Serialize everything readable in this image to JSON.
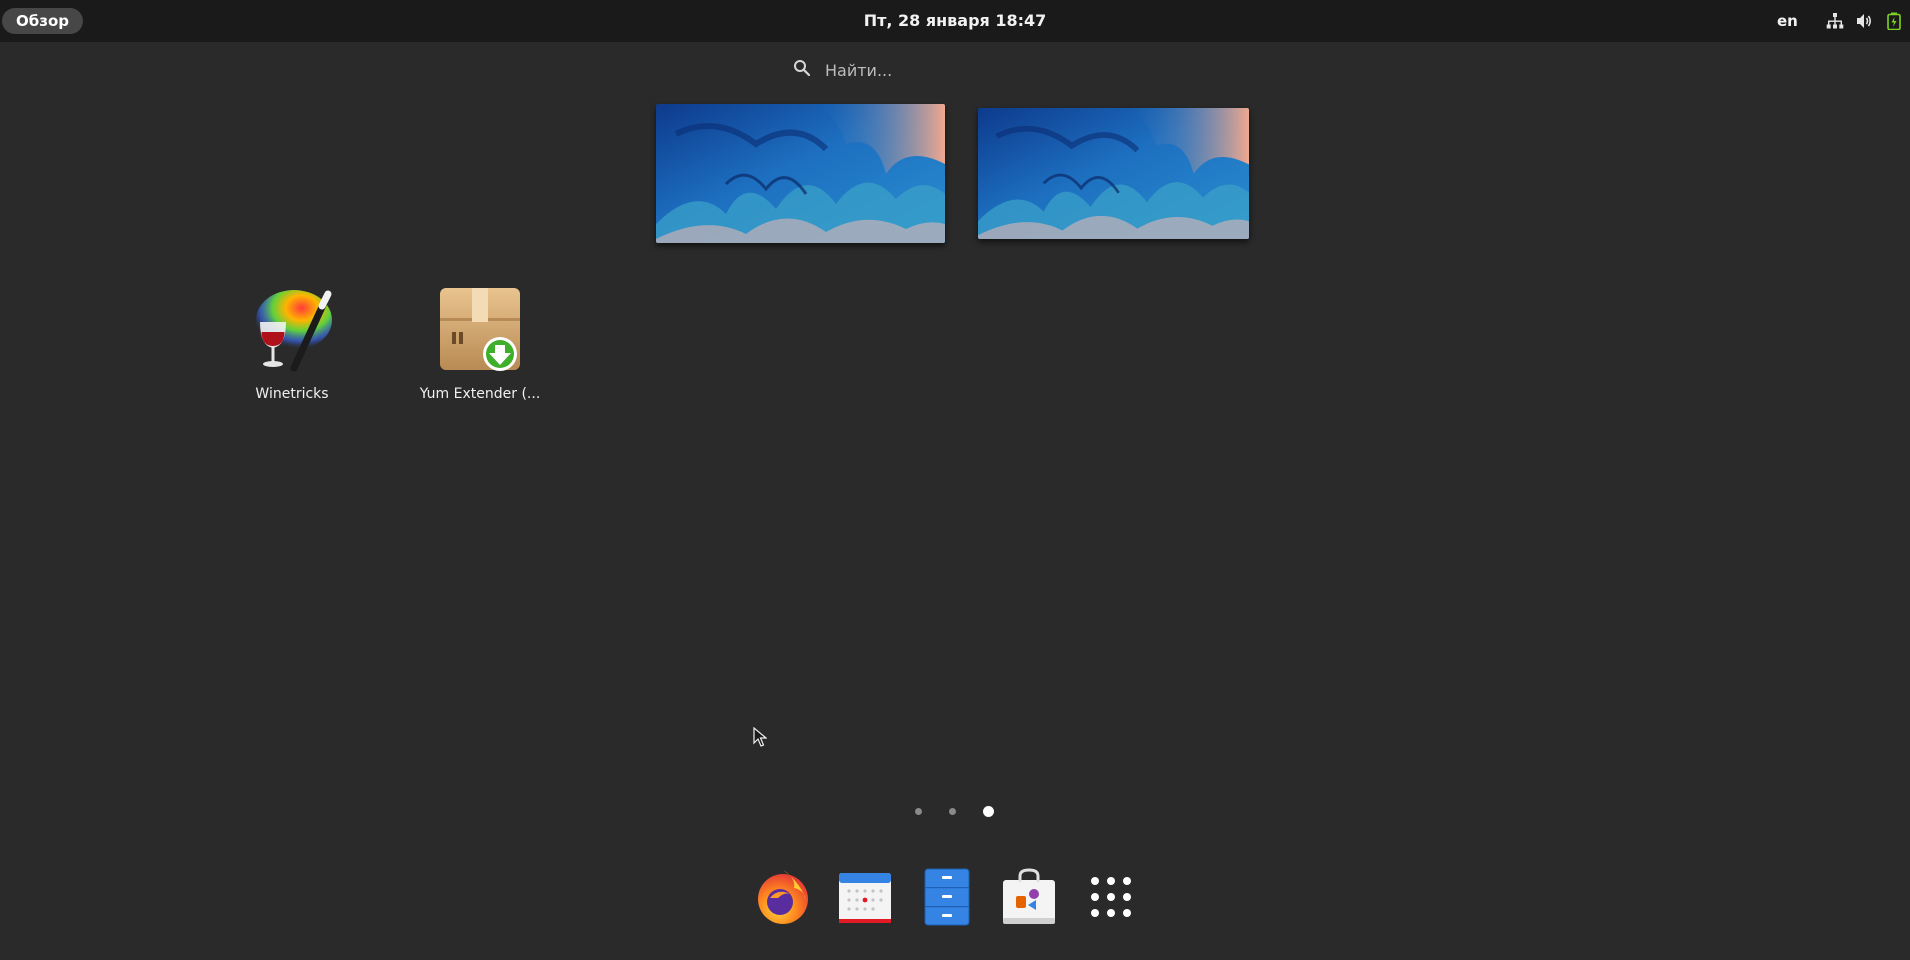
{
  "topbar": {
    "activities_label": "Обзор",
    "clock": "Пт, 28 января  18:47",
    "language": "en",
    "tray_icons": [
      "network-icon",
      "volume-icon",
      "battery-icon"
    ]
  },
  "search": {
    "placeholder": "Найти..."
  },
  "workspaces": [
    {
      "name": "workspace-1"
    },
    {
      "name": "workspace-2"
    }
  ],
  "apps": [
    {
      "label": "Winetricks",
      "icon": "winetricks-icon"
    },
    {
      "label": "Yum Extender (...",
      "icon": "yum-extender-icon"
    }
  ],
  "pages": {
    "count": 3,
    "active": 3
  },
  "dash": {
    "items": [
      "firefox-icon",
      "calendar-icon",
      "files-icon",
      "software-icon",
      "show-apps-icon"
    ]
  },
  "colors": {
    "background": "#2a2a2a",
    "topbar": "#1a1a1a",
    "wallpaper_blue": "#1f6fb5",
    "wallpaper_pink": "#e9a48c"
  }
}
